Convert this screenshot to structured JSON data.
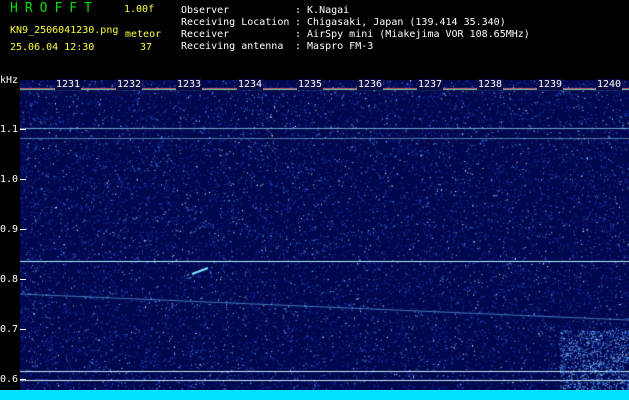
{
  "header": {
    "logo_text": "HROFFT",
    "version": "1.00f",
    "filename": "KN9_2506041230.png",
    "meteor_label": "meteor",
    "timestamp": "25.06.04 12:30",
    "meteor_count": "37",
    "info": [
      {
        "label": "Observer",
        "value": ": K.Nagai"
      },
      {
        "label": "Receiving Location",
        "value": ": Chigasaki, Japan (139.414 35.340)"
      },
      {
        "label": "Receiver",
        "value": ": AirSpy mini (Miakejima VOR 108.65MHz)"
      },
      {
        "label": "Receiving antenna",
        "value": ": Maspro FM-3"
      }
    ]
  },
  "axis": {
    "unit": "kHz",
    "ticks": [
      "1.1",
      "1.0",
      "0.9",
      "0.8",
      "0.7",
      "0.6"
    ]
  },
  "time_marks": [
    "1231",
    "1232",
    "1233",
    "1234",
    "1235",
    "1236",
    "1237",
    "1238",
    "1239",
    "1240"
  ],
  "colors": {
    "background": "#000000",
    "noise_floor": "#02084e",
    "header_green": "#00e000",
    "header_yellow": "#ffff40",
    "carrier_line": "#9fe8ff",
    "bottom_bar": "#00e0ff"
  }
}
